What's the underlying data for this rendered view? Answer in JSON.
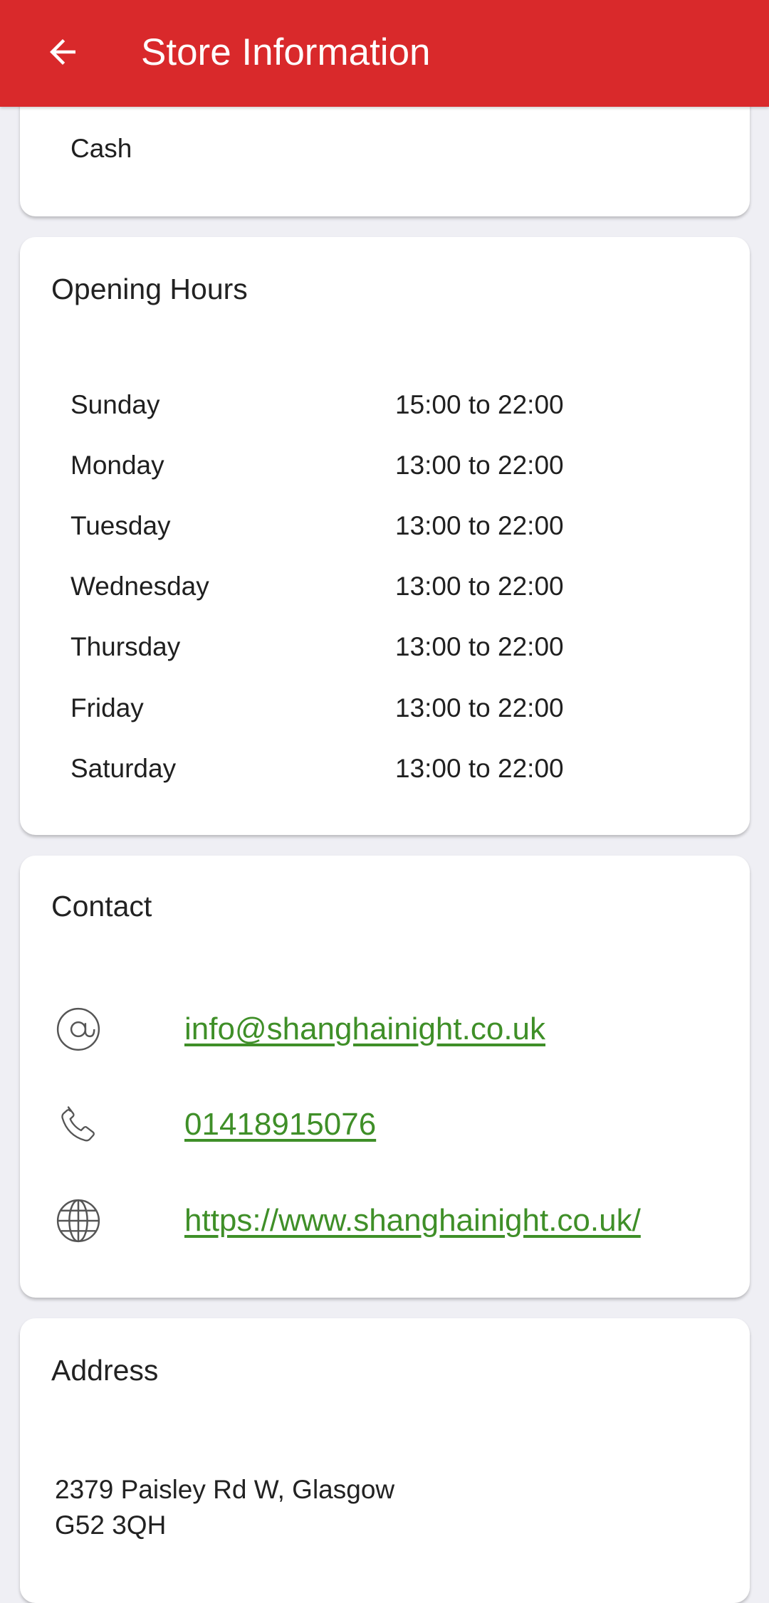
{
  "app_bar": {
    "title": "Store Information",
    "background": "#d9292b",
    "back_icon": "arrow-left-icon"
  },
  "payment": {
    "methods": [
      "Cash"
    ]
  },
  "opening_hours": {
    "title": "Opening Hours",
    "days": [
      {
        "day": "Sunday",
        "hours": "15:00 to 22:00"
      },
      {
        "day": "Monday",
        "hours": "13:00 to 22:00"
      },
      {
        "day": "Tuesday",
        "hours": "13:00 to 22:00"
      },
      {
        "day": "Wednesday",
        "hours": "13:00 to 22:00"
      },
      {
        "day": "Thursday",
        "hours": "13:00 to 22:00"
      },
      {
        "day": "Friday",
        "hours": "13:00 to 22:00"
      },
      {
        "day": "Saturday",
        "hours": "13:00 to 22:00"
      }
    ]
  },
  "contact": {
    "title": "Contact",
    "link_color": "#3f8f28",
    "email": {
      "icon": "at-sign-icon",
      "text": "info@shanghainight.co.uk"
    },
    "phone": {
      "icon": "phone-icon",
      "text": "01418915076"
    },
    "website": {
      "icon": "globe-icon",
      "text": "https://www.shanghainight.co.uk/"
    }
  },
  "address": {
    "title": "Address",
    "line1": "2379 Paisley Rd W, Glasgow",
    "line2": "G52 3QH"
  }
}
